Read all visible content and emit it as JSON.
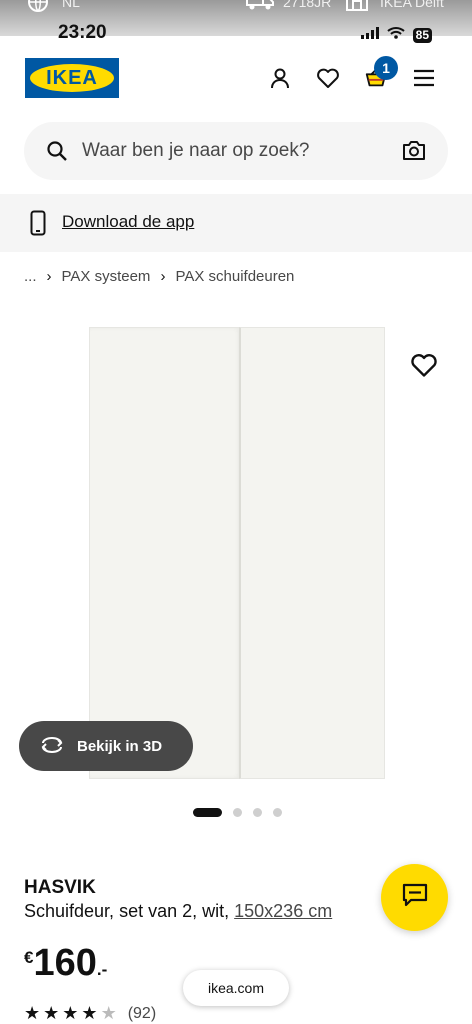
{
  "status_bar": {
    "locale": "NL",
    "time": "23:20",
    "postcode": "2718JR",
    "store": "IKEA Delft",
    "battery": "85"
  },
  "header": {
    "logo_text": "IKEA",
    "cart_count": "1",
    "brand_blue": "#0058a3",
    "brand_yellow": "#ffdb00"
  },
  "search": {
    "placeholder": "Waar ben je naar op zoek?"
  },
  "download_bar": {
    "label": "Download de app"
  },
  "breadcrumb": {
    "items": [
      "...",
      "PAX systeem",
      "PAX schuifdeuren"
    ]
  },
  "gallery": {
    "view3d_label": "Bekijk in 3D",
    "total_images": 4,
    "active_index": 0
  },
  "product": {
    "name": "HASVIK",
    "description": "Schuifdeur, set van 2, wit,",
    "size": "150x236 cm",
    "price_currency": "€",
    "price_integer": "160",
    "price_decimal": ".-",
    "rating_stars": 4,
    "rating_max": 5,
    "rating_count": "(92)"
  },
  "url_pill": "ikea.com"
}
